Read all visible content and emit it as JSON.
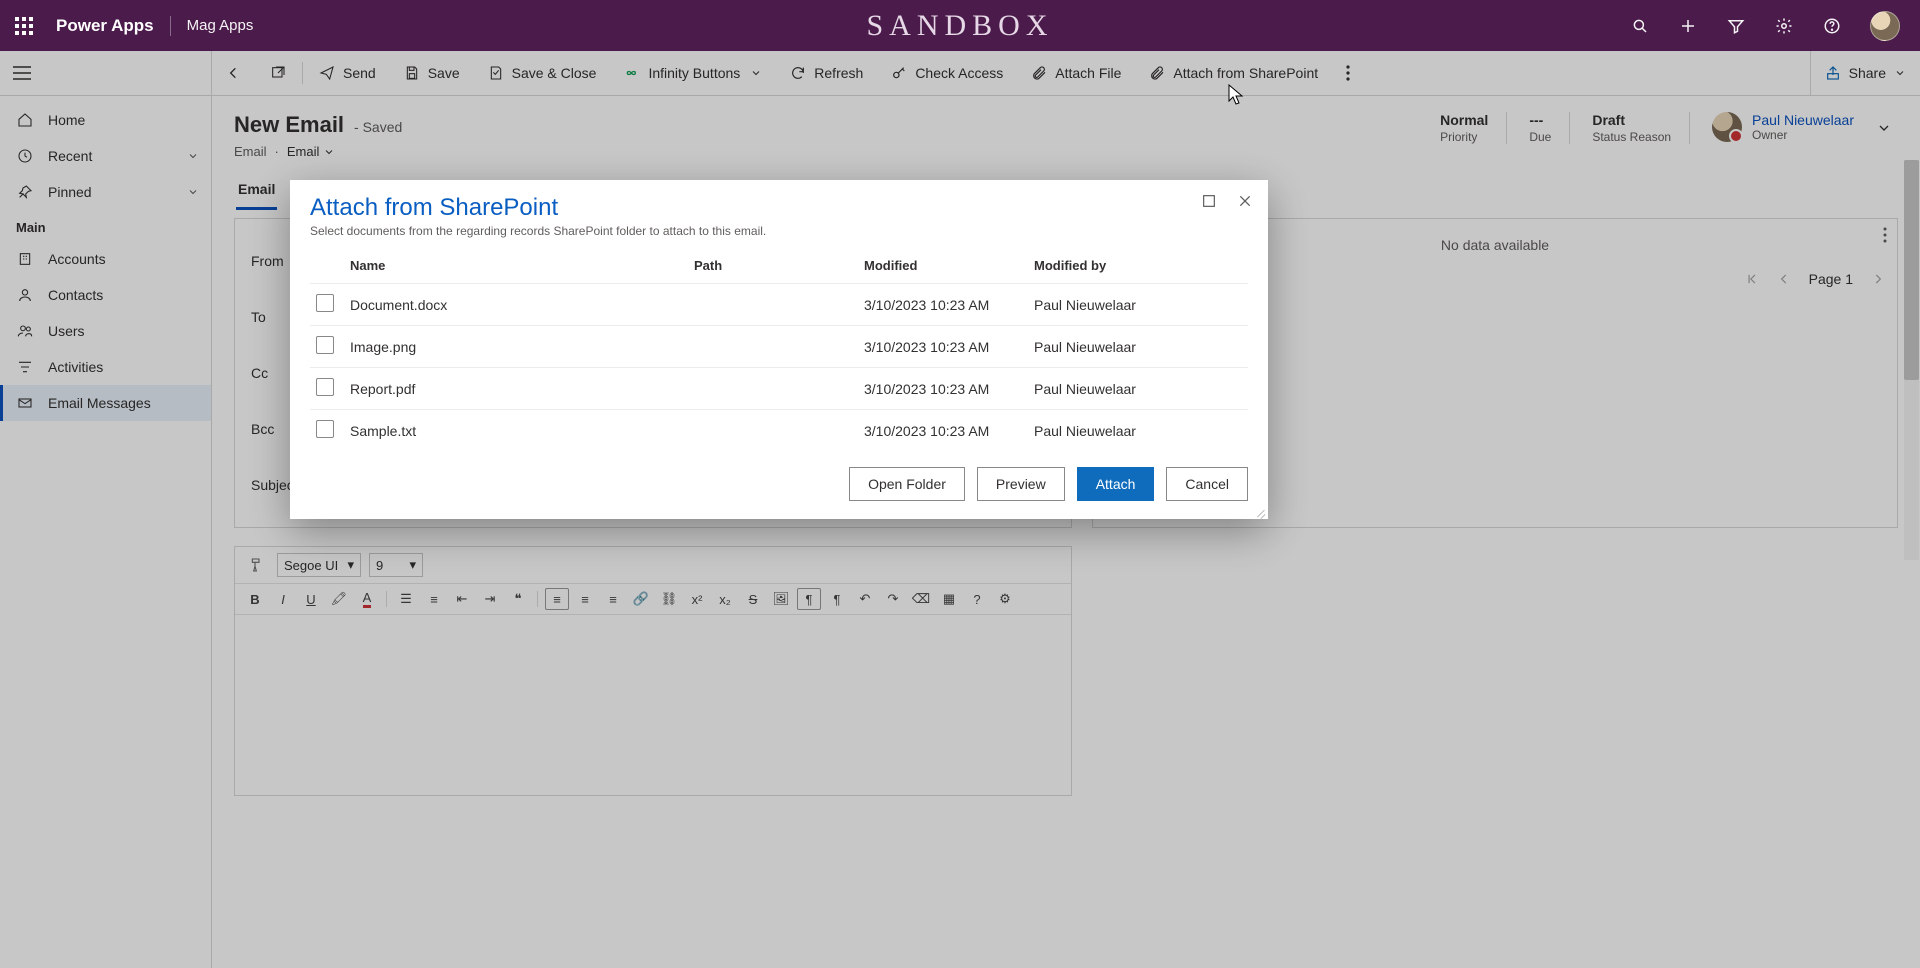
{
  "topbar": {
    "appLauncher": "Power Apps",
    "envName": "Mag Apps",
    "sandbox": "SANDBOX",
    "icons": [
      "search-icon",
      "plus-icon",
      "filter-icon",
      "gear-icon",
      "help-icon"
    ],
    "colors": {
      "background": "#4b1b4b"
    }
  },
  "commandbar": {
    "back": "Back",
    "popout": "Open in new window",
    "items": [
      {
        "icon": "send-icon",
        "label": "Send"
      },
      {
        "icon": "save-icon",
        "label": "Save"
      },
      {
        "icon": "save-close-icon",
        "label": "Save & Close"
      },
      {
        "icon": "infinity-icon",
        "label": "Infinity Buttons",
        "hasChevron": true
      },
      {
        "icon": "refresh-icon",
        "label": "Refresh"
      },
      {
        "icon": "key-icon",
        "label": "Check Access"
      },
      {
        "icon": "paperclip-icon",
        "label": "Attach File"
      },
      {
        "icon": "paperclip-icon",
        "label": "Attach from SharePoint"
      }
    ],
    "share": "Share"
  },
  "sidebar": {
    "home": "Home",
    "recent": "Recent",
    "pinned": "Pinned",
    "section": "Main",
    "items": [
      {
        "icon": "people-icon",
        "label": "Accounts"
      },
      {
        "icon": "person-icon",
        "label": "Contacts"
      },
      {
        "icon": "user-icon",
        "label": "Users"
      },
      {
        "icon": "activity-icon",
        "label": "Activities"
      },
      {
        "icon": "mail-icon",
        "label": "Email Messages",
        "selected": true
      }
    ]
  },
  "header": {
    "title": "New Email",
    "saved": "- Saved",
    "crumb1": "Email",
    "crumb2": "Email",
    "stats": [
      {
        "value": "Normal",
        "label": "Priority"
      },
      {
        "value": "---",
        "label": "Due"
      },
      {
        "value": "Draft",
        "label": "Status Reason"
      }
    ],
    "owner": {
      "name": "Paul Nieuwelaar",
      "role": "Owner"
    }
  },
  "tabs": [
    "Email"
  ],
  "form": {
    "fields": [
      "From",
      "To",
      "Cc",
      "Bcc",
      "Subject"
    ]
  },
  "sidecard": {
    "nodata": "No data available",
    "pageLabel": "Page 1"
  },
  "editor": {
    "paint": "Format painter",
    "font": "Segoe UI",
    "size": "9"
  },
  "dialog": {
    "title": "Attach from SharePoint",
    "subtitle": "Select documents from the regarding records SharePoint folder to attach to this email.",
    "columns": [
      "Name",
      "Path",
      "Modified",
      "Modified by"
    ],
    "rows": [
      {
        "name": "Document.docx",
        "path": "",
        "modified": "3/10/2023 10:23 AM",
        "by": "Paul Nieuwelaar"
      },
      {
        "name": "Image.png",
        "path": "",
        "modified": "3/10/2023 10:23 AM",
        "by": "Paul Nieuwelaar"
      },
      {
        "name": "Report.pdf",
        "path": "",
        "modified": "3/10/2023 10:23 AM",
        "by": "Paul Nieuwelaar"
      },
      {
        "name": "Sample.txt",
        "path": "",
        "modified": "3/10/2023 10:23 AM",
        "by": "Paul Nieuwelaar"
      }
    ],
    "buttons": {
      "openFolder": "Open Folder",
      "preview": "Preview",
      "attach": "Attach",
      "cancel": "Cancel"
    }
  }
}
